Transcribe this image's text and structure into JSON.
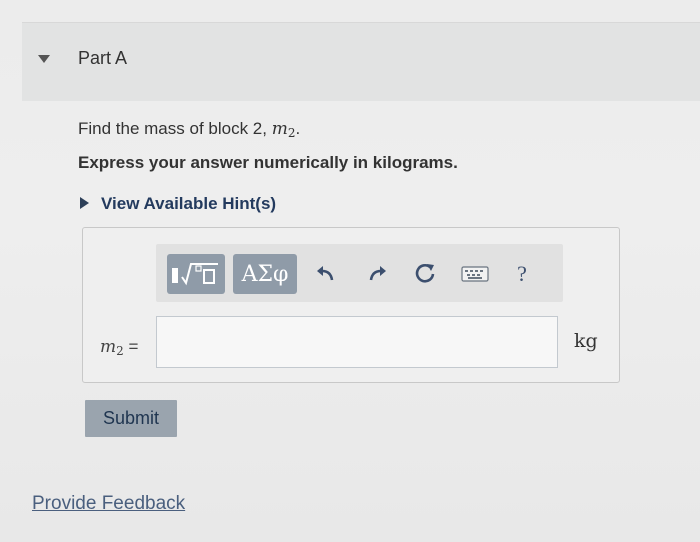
{
  "part": {
    "title": "Part A"
  },
  "question": {
    "prompt_text": "Find the mass of block 2,",
    "variable_symbol": "m",
    "variable_subscript": "2",
    "prompt_end": ".",
    "instruction": "Express your answer numerically in kilograms."
  },
  "hints": {
    "label": "View Available Hint(s)"
  },
  "toolbar": {
    "templates_label": "√□",
    "symbols_label": "ΑΣφ",
    "help_label": "?",
    "icons": [
      "templates-icon",
      "greek-symbols-icon",
      "undo-icon",
      "redo-icon",
      "reset-icon",
      "keyboard-icon",
      "help-icon"
    ]
  },
  "answer": {
    "variable_label": "m",
    "variable_subscript": "2",
    "equals": "=",
    "value": "",
    "unit": "kg"
  },
  "submit_label": "Submit",
  "feedback_label": "Provide Feedback",
  "colors": {
    "header_bg": "#e2e3e3",
    "link": "#233a5e",
    "button_bg": "#8f9ba8",
    "submit_bg": "#9aa4ae"
  }
}
